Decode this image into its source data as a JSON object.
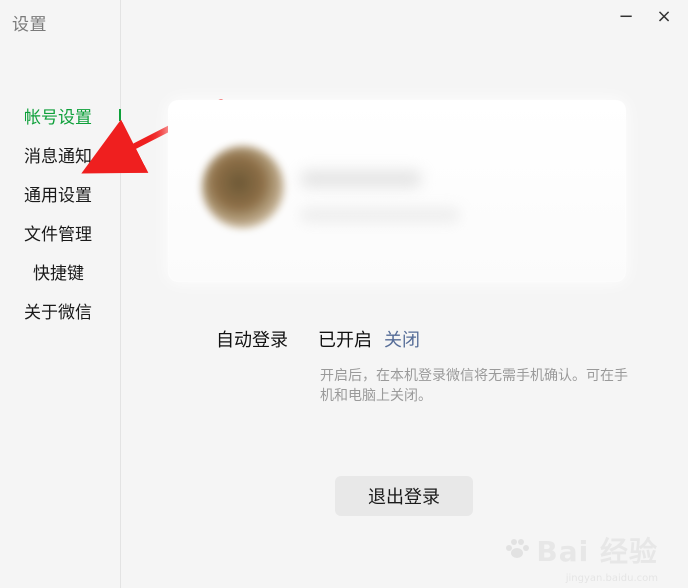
{
  "window": {
    "title": "设置",
    "controls": {
      "minimize": "−",
      "close": "×"
    }
  },
  "sidebar": {
    "items": [
      {
        "label": "帐号设置"
      },
      {
        "label": "消息通知"
      },
      {
        "label": "通用设置"
      },
      {
        "label": "文件管理"
      },
      {
        "label": "快捷键"
      },
      {
        "label": "关于微信"
      }
    ]
  },
  "account": {
    "auto_login_label": "自动登录",
    "auto_login_status": "已开启",
    "auto_login_action": "关闭",
    "hint": "开启后，在本机登录微信将无需手机确认。可在手机和电脑上关闭。",
    "logout_label": "退出登录"
  },
  "watermark": {
    "main": "Bai 经验",
    "sub": "jingyan.baidu.com"
  },
  "colors": {
    "active": "#0ea03a",
    "link": "#566d98",
    "annotation_arrow": "#ef1f1f"
  }
}
